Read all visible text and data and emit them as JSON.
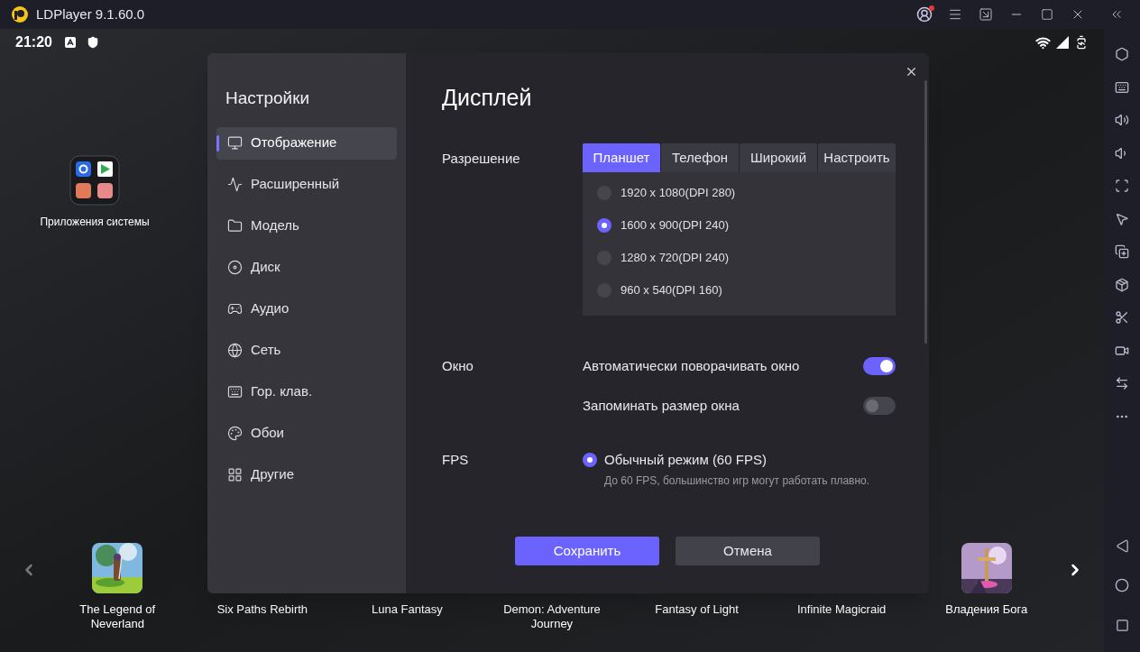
{
  "window": {
    "title": "LDPlayer 9.1.60.0",
    "account_notification": true
  },
  "status_bar": {
    "time": "21:20"
  },
  "desktop": {
    "folder_label": "Приложения системы"
  },
  "settings": {
    "title": "Настройки",
    "nav": [
      {
        "label": "Отображение",
        "selected": true
      },
      {
        "label": "Расширенный",
        "selected": false
      },
      {
        "label": "Модель",
        "selected": false
      },
      {
        "label": "Диск",
        "selected": false
      },
      {
        "label": "Аудио",
        "selected": false
      },
      {
        "label": "Сеть",
        "selected": false
      },
      {
        "label": "Гор. клав.",
        "selected": false
      },
      {
        "label": "Обои",
        "selected": false
      },
      {
        "label": "Другие",
        "selected": false
      }
    ],
    "heading": "Дисплей",
    "resolution": {
      "label": "Разрешение",
      "tabs": [
        {
          "label": "Планшет",
          "selected": true
        },
        {
          "label": "Телефон",
          "selected": false
        },
        {
          "label": "Широкий",
          "selected": false
        },
        {
          "label": "Настроить",
          "selected": false
        }
      ],
      "options": [
        {
          "label": "1920 x 1080(DPI 280)",
          "selected": false
        },
        {
          "label": "1600 x 900(DPI 240)",
          "selected": true
        },
        {
          "label": "1280 x 720(DPI 240)",
          "selected": false
        },
        {
          "label": "960 x 540(DPI 160)",
          "selected": false
        }
      ]
    },
    "window_options": {
      "label": "Окно",
      "toggles": [
        {
          "label": "Автоматически поворачивать окно",
          "on": true
        },
        {
          "label": "Запоминать размер окна",
          "on": false
        }
      ]
    },
    "fps": {
      "label": "FPS",
      "options": [
        {
          "label": "Обычный режим (60 FPS)",
          "hint": "До 60 FPS, большинство игр могут работать плавно.",
          "selected": true
        }
      ]
    },
    "buttons": [
      {
        "label": "Сохранить",
        "kind": "primary"
      },
      {
        "label": "Отмена",
        "kind": "secondary"
      }
    ]
  },
  "dock": {
    "games": [
      {
        "title": "The Legend of Neverland",
        "kind": "picture"
      },
      {
        "title": "Six Paths Rebirth"
      },
      {
        "title": "Luna Fantasy"
      },
      {
        "title": "Demon: Adventure Journey"
      },
      {
        "title": "Fantasy of Light"
      },
      {
        "title": "Infinite Magicraid"
      },
      {
        "title": "Владения Бога",
        "kind": "picture"
      }
    ]
  }
}
